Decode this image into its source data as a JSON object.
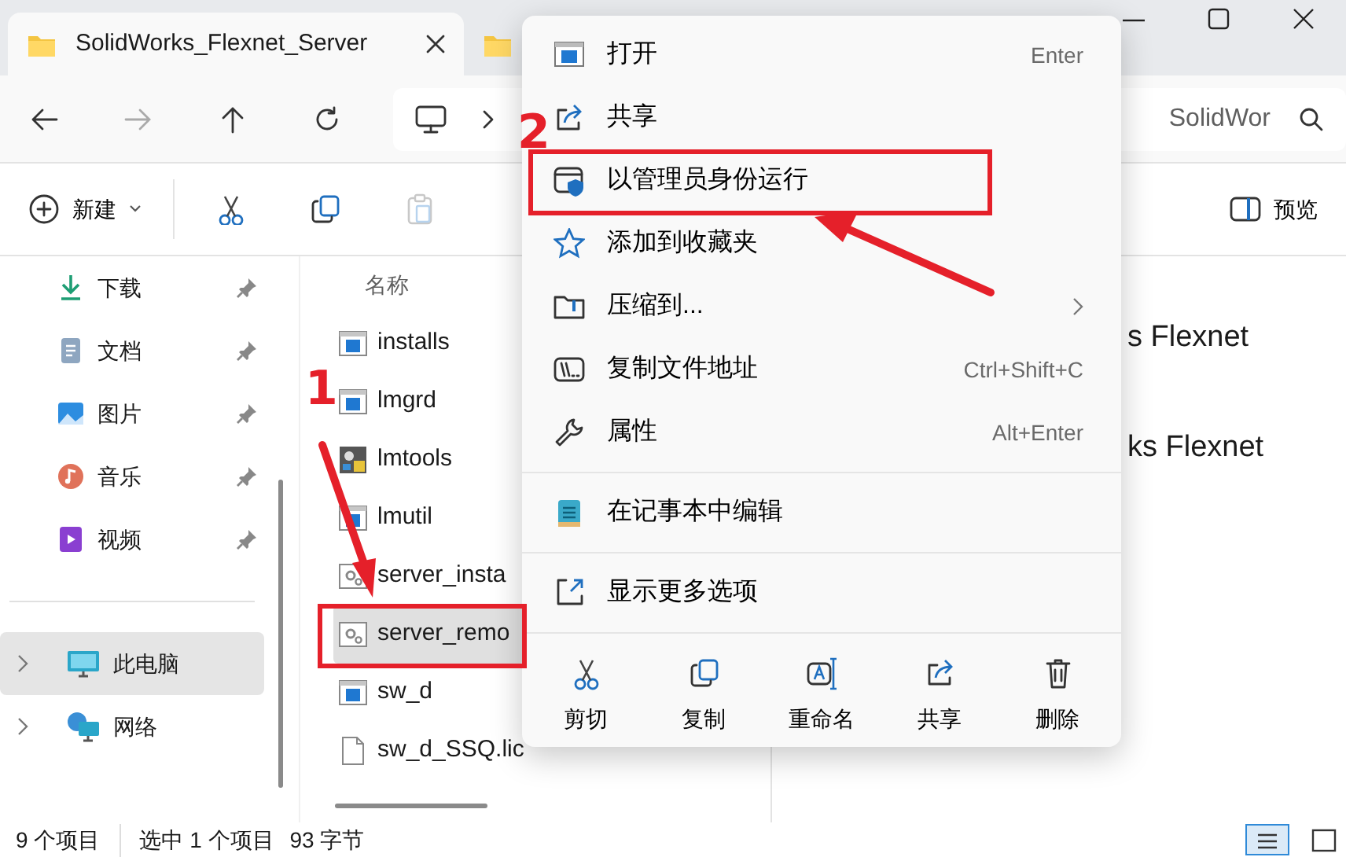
{
  "tabs": [
    {
      "title": "SolidWorks_Flexnet_Server",
      "selected": true
    },
    {
      "selected": false
    }
  ],
  "search": {
    "placeholder": "SolidWor"
  },
  "toolbar": {
    "new_button": "新建",
    "preview_button": "预览",
    "paste_disabled": true
  },
  "sidebar": {
    "quick_access": [
      {
        "label": "下载",
        "pinned": true,
        "selected": false
      },
      {
        "label": "文档",
        "pinned": true,
        "selected": false
      },
      {
        "label": "图片",
        "pinned": true,
        "selected": false
      },
      {
        "label": "音乐",
        "pinned": true,
        "selected": false
      },
      {
        "label": "视频",
        "pinned": true,
        "selected": false
      }
    ],
    "locations": [
      {
        "label": "此电脑",
        "expanded": false,
        "selected": true
      },
      {
        "label": "网络",
        "expanded": false,
        "selected": false
      }
    ]
  },
  "file_list": {
    "column": "名称",
    "files": [
      {
        "name": "installs",
        "kind": "exe",
        "selected": false
      },
      {
        "name": "lmgrd",
        "kind": "exe",
        "selected": false
      },
      {
        "name": "lmtools",
        "kind": "tool",
        "selected": false
      },
      {
        "name": "lmutil",
        "kind": "exe",
        "selected": false
      },
      {
        "name": "server_insta",
        "kind": "script",
        "selected": false
      },
      {
        "name": "server_remo",
        "kind": "script",
        "selected": true
      },
      {
        "name": "sw_d",
        "kind": "exe",
        "selected": false
      },
      {
        "name": "sw_d_SSQ.lic",
        "kind": "text",
        "selected": false
      }
    ]
  },
  "preview": {
    "lines": [
      "s Flexnet",
      "ks Flexnet"
    ]
  },
  "context_menu": {
    "items": [
      {
        "kind": "item",
        "label": "打开",
        "shortcut": "Enter",
        "submenu": false
      },
      {
        "kind": "item",
        "label": "共享",
        "submenu": false
      },
      {
        "kind": "item",
        "label": "以管理员身份运行",
        "submenu": false
      },
      {
        "kind": "item",
        "label": "添加到收藏夹",
        "submenu": false
      },
      {
        "kind": "item",
        "label": "压缩到...",
        "submenu": true
      },
      {
        "kind": "item",
        "label": "复制文件地址",
        "shortcut": "Ctrl+Shift+C",
        "submenu": false
      },
      {
        "kind": "item",
        "label": "属性",
        "shortcut": "Alt+Enter",
        "submenu": false
      },
      {
        "kind": "separator"
      },
      {
        "kind": "item",
        "label": "在记事本中编辑",
        "submenu": false
      },
      {
        "kind": "separator"
      },
      {
        "kind": "item",
        "label": "显示更多选项",
        "submenu": false
      },
      {
        "kind": "separator"
      }
    ],
    "actions": [
      {
        "label": "剪切"
      },
      {
        "label": "复制"
      },
      {
        "label": "重命名"
      },
      {
        "label": "共享"
      },
      {
        "label": "删除"
      }
    ]
  },
  "status_bar": {
    "item_count": "9 个项目",
    "selection": "选中 1 个项目",
    "size": "93 字节"
  },
  "views": [
    {
      "selected": true
    },
    {
      "selected": false
    }
  ],
  "annotations": [
    {
      "label": "1"
    },
    {
      "label": "2"
    }
  ]
}
